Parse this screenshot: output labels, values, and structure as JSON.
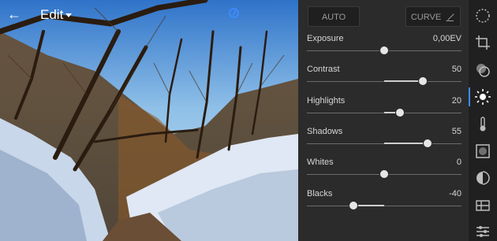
{
  "header": {
    "title": "Edit",
    "back_icon": "back-arrow-icon",
    "info_icon": "info-icon"
  },
  "panel": {
    "auto_label": "AUTO",
    "curve_label": "CURVE",
    "sliders": [
      {
        "label": "Exposure",
        "value": "0,00EV",
        "level": 0.5,
        "center": 0.5
      },
      {
        "label": "Contrast",
        "value": "50",
        "level": 0.75,
        "center": 0.5
      },
      {
        "label": "Highlights",
        "value": "20",
        "level": 0.6,
        "center": 0.5
      },
      {
        "label": "Shadows",
        "value": "55",
        "level": 0.78,
        "center": 0.5
      },
      {
        "label": "Whites",
        "value": "0",
        "level": 0.5,
        "center": 0.5
      },
      {
        "label": "Blacks",
        "value": "-40",
        "level": 0.3,
        "center": 0.5
      }
    ]
  },
  "rail": {
    "tools": [
      "presets-icon",
      "crop-icon",
      "color-mix-icon",
      "light-icon",
      "temperature-icon",
      "vignette-icon",
      "detail-icon",
      "optics-icon",
      "settings-sliders-icon"
    ],
    "active": "light-icon",
    "accent": "#3d8bff"
  }
}
